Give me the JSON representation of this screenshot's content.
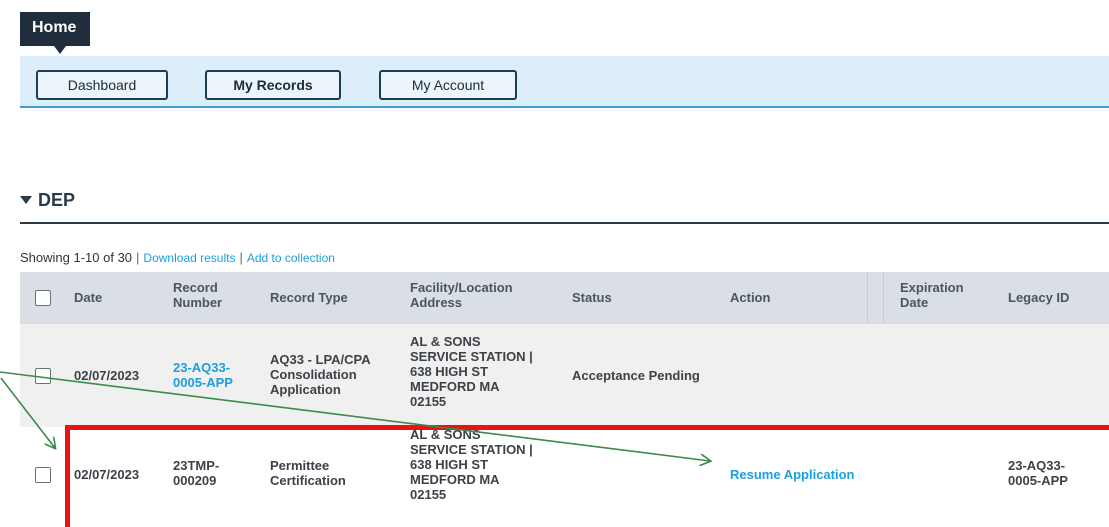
{
  "header": {
    "home_label": "Home"
  },
  "nav": {
    "dashboard": "Dashboard",
    "my_records": "My Records",
    "my_account": "My Account"
  },
  "section": {
    "title": "DEP"
  },
  "summary": {
    "showing": "Showing 1-10 of 30",
    "download": "Download results",
    "add_collection": "Add to collection",
    "separator": "|"
  },
  "table": {
    "columns": {
      "date": "Date",
      "record_number_1": "Record",
      "record_number_2": "Number",
      "record_type": "Record Type",
      "facility_1": "Facility/Location",
      "facility_2": "Address",
      "status": "Status",
      "action": "Action",
      "expiration_1": "Expiration",
      "expiration_2": "Date",
      "legacy_id": "Legacy ID"
    },
    "rows": [
      {
        "date": "02/07/2023",
        "record_number_1": "23-AQ33-",
        "record_number_2": "0005-APP",
        "record_type_1": "AQ33 - LPA/CPA",
        "record_type_2": "Consolidation",
        "record_type_3": "Application",
        "address_1": "AL & SONS",
        "address_2": "SERVICE STATION |",
        "address_3": "638 HIGH ST",
        "address_4": "MEDFORD MA",
        "address_5": "02155",
        "status": "Acceptance Pending",
        "action": "",
        "expiration": "",
        "legacy_id_1": "",
        "legacy_id_2": ""
      },
      {
        "date": "02/07/2023",
        "record_number_1": "23TMP-",
        "record_number_2": "000209",
        "record_type_1": "Permittee",
        "record_type_2": "Certification",
        "record_type_3": "",
        "address_1": "AL & SONS",
        "address_2": "SERVICE STATION |",
        "address_3": "638 HIGH ST",
        "address_4": "MEDFORD MA",
        "address_5": "02155",
        "status": "",
        "action": "Resume Application",
        "expiration": "",
        "legacy_id_1": "23-AQ33-",
        "legacy_id_2": "0005-APP"
      }
    ]
  },
  "colors": {
    "highlight": "#ee1111",
    "arrow": "#3d8a4f",
    "link": "#1a9fe0",
    "header_dark": "#1f2d3d"
  }
}
